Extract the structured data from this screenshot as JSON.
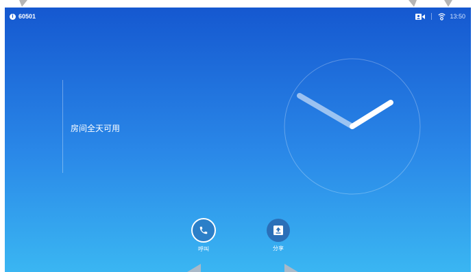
{
  "status_bar": {
    "system_number": "60501",
    "time": "13:50",
    "icons": [
      "info-icon",
      "camera-icon",
      "wifi-icon"
    ]
  },
  "room": {
    "status_text": "房间全天可用"
  },
  "clock": {
    "time_shown": "13:50"
  },
  "actions": {
    "call_label": "呼叫",
    "share_label": "分享"
  },
  "colors": {
    "gradient_top": "#1558d0",
    "gradient_bottom": "#3ab6f2",
    "call_button": "#2c7fc8",
    "share_button": "#2a6fb8"
  }
}
